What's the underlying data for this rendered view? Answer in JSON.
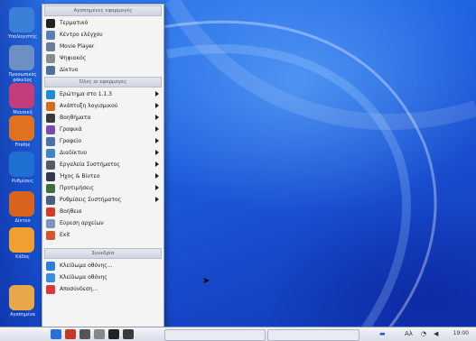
{
  "menu": {
    "section_favorites": "Αγαπημένες εφαρμογές",
    "favorites": [
      {
        "label": "Τερματικό",
        "icon": "terminal-icon",
        "color": "#222222"
      },
      {
        "label": "Κέντρο ελέγχου",
        "icon": "control-center-icon",
        "color": "#5a7fb8"
      },
      {
        "label": "Movie Player",
        "icon": "movie-player-icon",
        "color": "#6b7d96"
      },
      {
        "label": "Ψηφιακός",
        "icon": "media-icon",
        "color": "#8a8a8a"
      },
      {
        "label": "Δίκτυο",
        "icon": "network-icon",
        "color": "#4f6e9e"
      }
    ],
    "section_apps": "Όλες οι εφαρμογές",
    "apps": [
      {
        "label": "Ερώτημα στο 1.1.3",
        "icon": "paint-icon",
        "color": "#1f8bd6",
        "submenu": true
      },
      {
        "label": "Ανάπτυξη λογισμικού",
        "icon": "development-icon",
        "color": "#d76a1d",
        "submenu": true
      },
      {
        "label": "Βοηθήματα",
        "icon": "accessories-icon",
        "color": "#3a3a3a",
        "submenu": true
      },
      {
        "label": "Γραφικά",
        "icon": "graphics-icon",
        "color": "#7a4bb0",
        "submenu": true
      },
      {
        "label": "Γραφείο",
        "icon": "office-icon",
        "color": "#4b6fa8",
        "submenu": true
      },
      {
        "label": "Διαδίκτυο",
        "icon": "internet-icon",
        "color": "#3b85c9",
        "submenu": true
      },
      {
        "label": "Εργαλεία Συστήματος",
        "icon": "system-tools-icon",
        "color": "#555b66",
        "submenu": true
      },
      {
        "label": "Ήχος & Βίντεο",
        "icon": "sound-video-icon",
        "color": "#303a48",
        "submenu": true
      },
      {
        "label": "Προτιμήσεις",
        "icon": "preferences-icon",
        "color": "#3f6e3a",
        "submenu": true
      },
      {
        "label": "Ρυθμίσεις Συστήματος",
        "icon": "system-settings-icon",
        "color": "#4a5d7a",
        "submenu": true
      },
      {
        "label": "Βοήθεια",
        "icon": "help-icon",
        "color": "#d43b2b",
        "submenu": false
      },
      {
        "label": "Εύρεση αρχείων",
        "icon": "find-files-icon",
        "color": "#7d95bd",
        "submenu": false
      },
      {
        "label": "Exit",
        "icon": "exit-icon",
        "color": "#d4552b",
        "submenu": false
      }
    ],
    "section_session": "Συνεδρία",
    "session": [
      {
        "label": "Κλείδωμα οθόνης...",
        "icon": "lock-screen-icon",
        "color": "#2a7fd6"
      },
      {
        "label": "Κλείδωμα οθόνης",
        "icon": "logout-icon",
        "color": "#3a8ee0"
      },
      {
        "label": "Αποσύνδεση...",
        "icon": "shutdown-icon",
        "color": "#d83a3a"
      }
    ]
  },
  "dock": {
    "items": [
      {
        "name": "computer",
        "icon": "computer-icon",
        "color": "#3a7fd8",
        "label": "Υπολογιστής"
      },
      {
        "name": "home",
        "icon": "home-folder-icon",
        "color": "#6d8fc4",
        "label": "Προσωπικός φάκελος"
      },
      {
        "name": "music",
        "icon": "music-icon",
        "color": "#c23d7a",
        "label": "Μουσική"
      },
      {
        "name": "firefox",
        "icon": "firefox-icon",
        "color": "#e0711f",
        "label": "Firefox"
      },
      {
        "name": "settings",
        "icon": "gear-icon",
        "color": "#1f6fd0",
        "label": "Ρυθμίσεις"
      },
      {
        "name": "network",
        "icon": "network-icon",
        "color": "#d8631d",
        "label": "Δίκτυο"
      },
      {
        "name": "trash",
        "icon": "trash-icon",
        "color": "#f0a030",
        "label": "Κάδος"
      },
      {
        "name": "favorites",
        "icon": "heart-icon",
        "color": "#e8a84a",
        "label": "Αγαπημένα"
      }
    ]
  },
  "taskbar": {
    "clock": "19:00",
    "tray_text": "Αλ"
  }
}
